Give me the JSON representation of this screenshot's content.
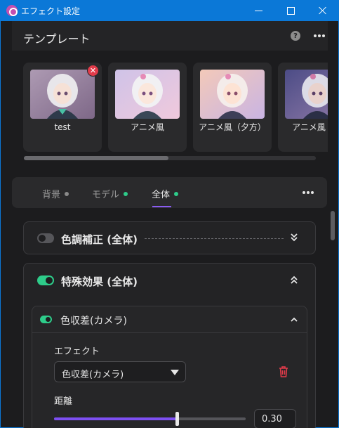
{
  "window": {
    "title": "エフェクト設定"
  },
  "header": {
    "title": "テンプレート",
    "help_glyph": "?"
  },
  "templates": [
    {
      "label": "test",
      "deletable": true
    },
    {
      "label": "アニメ風"
    },
    {
      "label": "アニメ風（夕方）"
    },
    {
      "label": "アニメ風（夜"
    }
  ],
  "tabs": [
    {
      "label": "背景",
      "dot_color": "#8a8a8a"
    },
    {
      "label": "モデル",
      "dot_color": "#2ecc8a"
    },
    {
      "label": "全体",
      "dot_color": "#2ecc8a",
      "active": true
    }
  ],
  "sections": {
    "color_correction": {
      "title": "色調補正 (全体)",
      "enabled": false,
      "expanded": false
    },
    "special_effects": {
      "title": "特殊効果 (全体)",
      "enabled": true,
      "expanded": true
    }
  },
  "effect": {
    "title": "色収差(カメラ)",
    "enabled": true,
    "effect_label": "エフェクト",
    "effect_value": "色収差(カメラ)",
    "distance_label": "距離",
    "distance_value": "0.30",
    "distance_fraction": 0.64
  },
  "colors": {
    "accent": "#8a5cf0",
    "toggle_on": "#2ecc8a",
    "danger": "#e23b4a",
    "titlebar": "#0b78d7"
  }
}
